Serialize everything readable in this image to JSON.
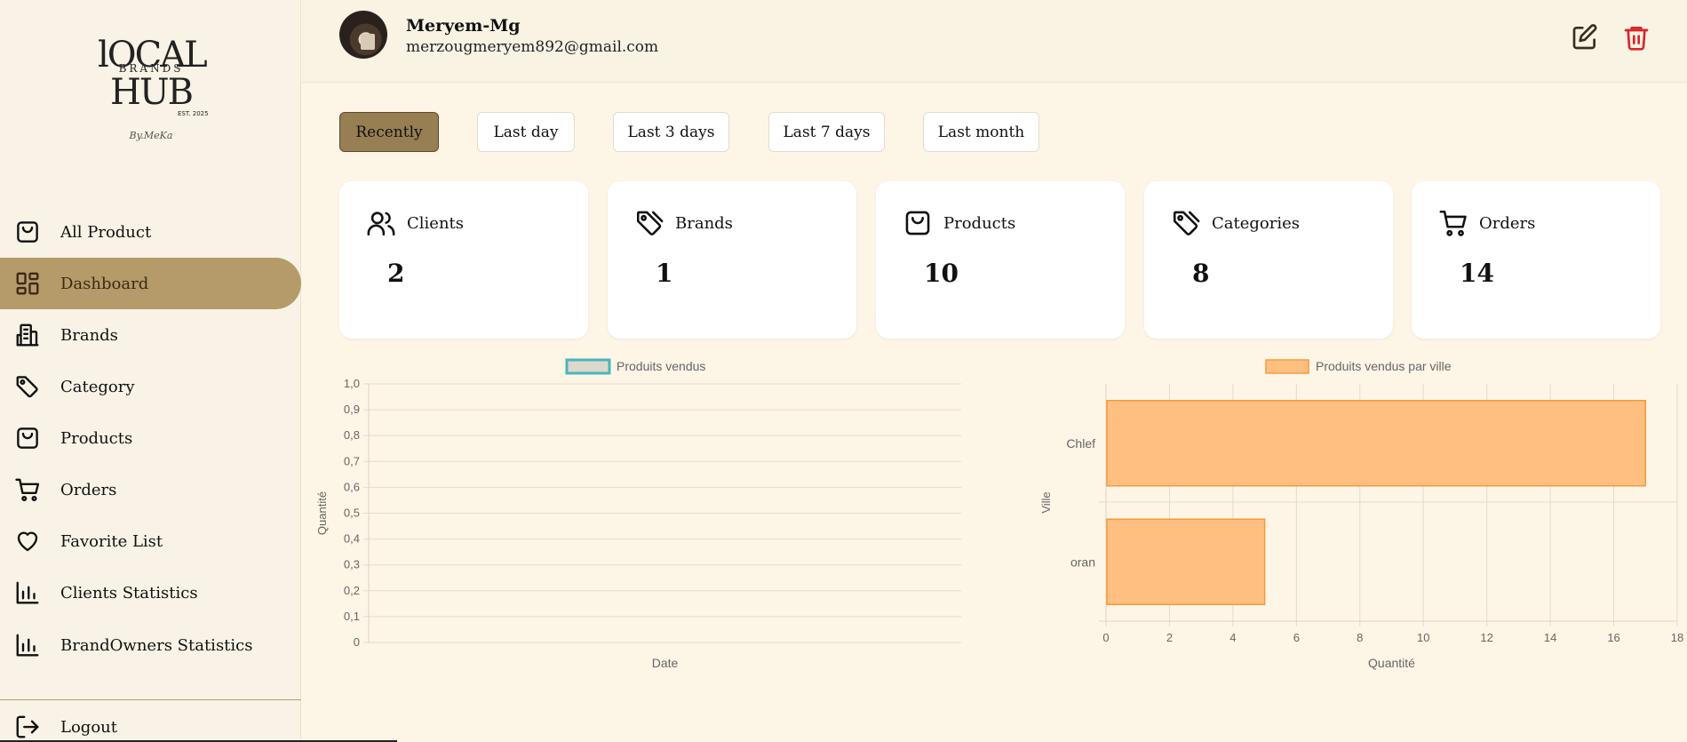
{
  "sidebar": {
    "logo": {
      "line1": "lOCAL",
      "line2": "BRANDS",
      "line3": "HUB",
      "est": "EST. 2025",
      "by": "By.MeKa"
    },
    "items": [
      {
        "label": "All Product",
        "icon": "shopping-bag-icon"
      },
      {
        "label": "Dashboard",
        "icon": "dashboard-grid-icon",
        "active": true
      },
      {
        "label": "Brands",
        "icon": "building-icon"
      },
      {
        "label": "Category",
        "icon": "tag-icon"
      },
      {
        "label": "Products",
        "icon": "shopping-bag-icon"
      },
      {
        "label": "Orders",
        "icon": "cart-icon"
      },
      {
        "label": "Favorite List",
        "icon": "heart-icon"
      },
      {
        "label": "Clients Statistics",
        "icon": "bar-chart-icon"
      },
      {
        "label": "BrandOwners Statistics",
        "icon": "bar-chart-icon"
      }
    ],
    "logout": "Logout"
  },
  "header": {
    "name": "Meryem-Mg",
    "email": "merzougmeryem892@gmail.com",
    "edit_icon": "edit-icon",
    "delete_icon": "trash-icon"
  },
  "filters": [
    "Recently",
    "Last day",
    "Last 3 days",
    "Last 7 days",
    "Last month"
  ],
  "active_filter": "Recently",
  "stats": [
    {
      "title": "Clients",
      "value": "2",
      "icon": "users-icon"
    },
    {
      "title": "Brands",
      "value": "1",
      "icon": "tag-icon"
    },
    {
      "title": "Products",
      "value": "10",
      "icon": "shopping-bag-icon"
    },
    {
      "title": "Categories",
      "value": "8",
      "icon": "tag-icon"
    },
    {
      "title": "Orders",
      "value": "14",
      "icon": "cart-icon"
    }
  ],
  "colors": {
    "sidebar_active": "#b59b6a",
    "filter_active": "#977f53",
    "delete": "#d9262c",
    "bar_fill": "#ffbf80",
    "bar_stroke": "#f59a3c",
    "line_legend_stroke": "#4bb5bd"
  },
  "chart_data": [
    {
      "type": "line",
      "legend": [
        "Produits vendus"
      ],
      "series": [
        {
          "name": "Produits vendus",
          "values": []
        }
      ],
      "xlabel": "Date",
      "ylabel": "Quantité",
      "ylim": [
        0,
        1
      ],
      "yticks": [
        "0",
        "0,1",
        "0,2",
        "0,3",
        "0,4",
        "0,5",
        "0,6",
        "0,7",
        "0,8",
        "0,9",
        "1,0"
      ],
      "grid": true,
      "legend_position": "top"
    },
    {
      "type": "bar",
      "orientation": "horizontal",
      "legend": [
        "Produits vendus par ville"
      ],
      "categories": [
        "Chlef",
        "oran"
      ],
      "series": [
        {
          "name": "Produits vendus par ville",
          "values": [
            17,
            5
          ]
        }
      ],
      "xlabel": "Quantité",
      "ylabel": "Ville",
      "xlim": [
        0,
        18
      ],
      "xticks": [
        "0",
        "2",
        "4",
        "6",
        "8",
        "10",
        "12",
        "14",
        "16",
        "18"
      ],
      "grid": true,
      "legend_position": "top"
    }
  ]
}
